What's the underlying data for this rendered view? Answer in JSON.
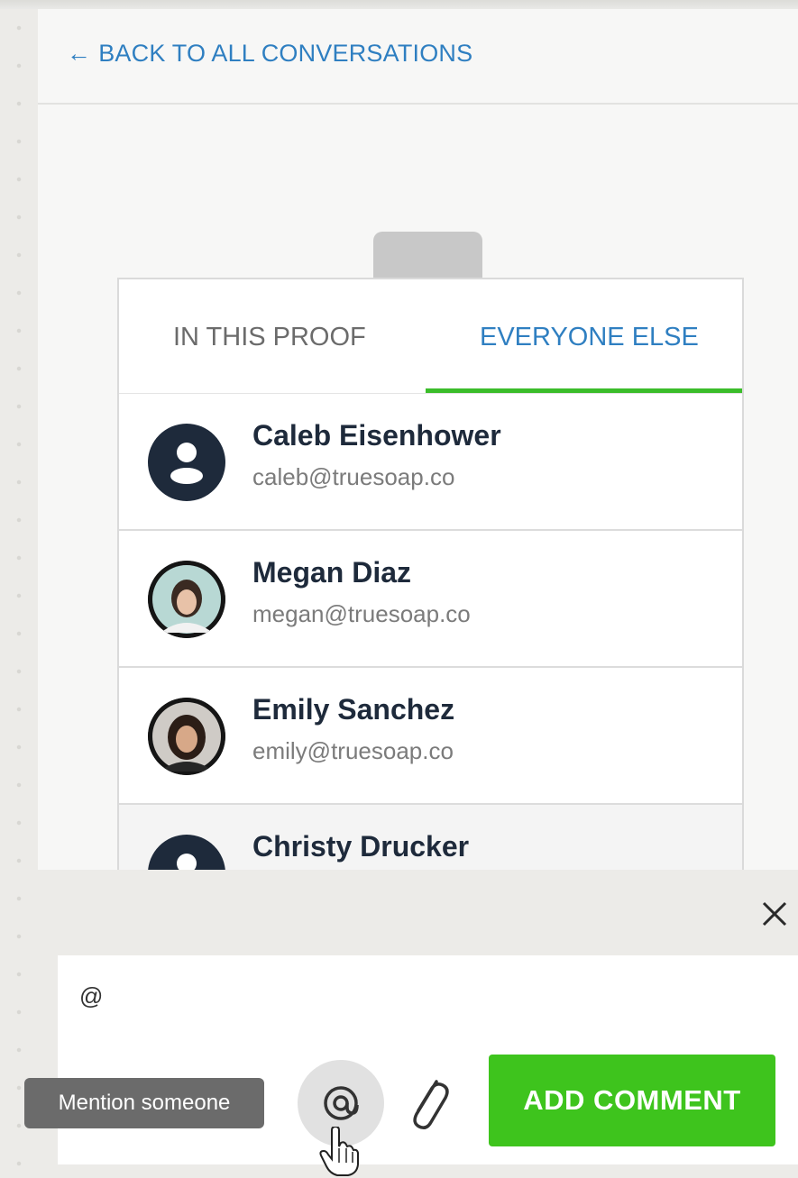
{
  "header": {
    "back_arrow": "←",
    "back_label": "BACK TO ALL CONVERSATIONS"
  },
  "mention_popup": {
    "tabs": [
      {
        "label": "IN THIS PROOF",
        "active": false
      },
      {
        "label": "EVERYONE ELSE",
        "active": true
      }
    ],
    "people": [
      {
        "name": "Caleb Eisenhower",
        "email": "caleb@truesoap.co",
        "avatar": "default-user-icon"
      },
      {
        "name": "Megan Diaz",
        "email": "megan@truesoap.co",
        "avatar": "photo"
      },
      {
        "name": "Emily Sanchez",
        "email": "emily@truesoap.co",
        "avatar": "photo"
      },
      {
        "name": "Christy Drucker",
        "email": "",
        "avatar": "default-user-icon"
      }
    ]
  },
  "composer": {
    "text": "@",
    "close_icon": "close-icon",
    "mention_icon": "at-icon",
    "attach_icon": "paperclip-icon",
    "submit_label": "ADD COMMENT",
    "tooltip": "Mention someone"
  },
  "colors": {
    "accent_blue": "#2f7fc1",
    "accent_green": "#3ec41d",
    "avatar_navy": "#1e2a3b"
  }
}
